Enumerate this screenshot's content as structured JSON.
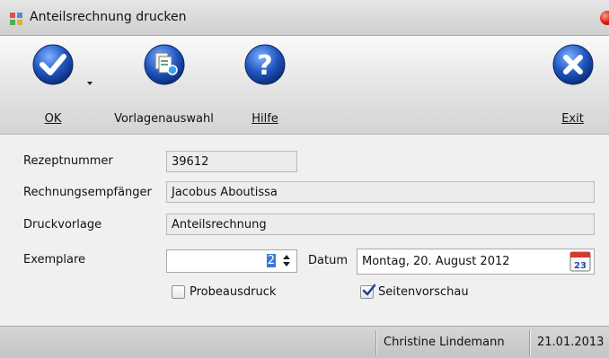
{
  "window": {
    "title": "Anteilsrechnung drucken"
  },
  "toolbar": {
    "ok_label": "OK",
    "vorlage_label": "Vorlagenauswahl",
    "hilfe_label": "Hilfe",
    "exit_label": "Exit"
  },
  "form": {
    "rezeptnummer_label": "Rezeptnummer",
    "rezeptnummer_value": "39612",
    "empfaenger_label": "Rechnungsempfänger",
    "empfaenger_value": "Jacobus Aboutissa",
    "druckvorlage_label": "Druckvorlage",
    "druckvorlage_value": "Anteilsrechnung",
    "exemplare_label": "Exemplare",
    "exemplare_value": "2",
    "datum_label": "Datum",
    "datum_value": "Montag, 20. August 2012",
    "calendar_day": "23",
    "probeausdruck_label": "Probeausdruck",
    "probeausdruck_checked": false,
    "seitenvorschau_label": "Seitenvorschau",
    "seitenvorschau_checked": true
  },
  "status": {
    "user": "Christine Lindemann",
    "date": "21.01.2013"
  },
  "colors": {
    "accent_blue": "#1f4fa8",
    "close_red": "#d41a10"
  }
}
